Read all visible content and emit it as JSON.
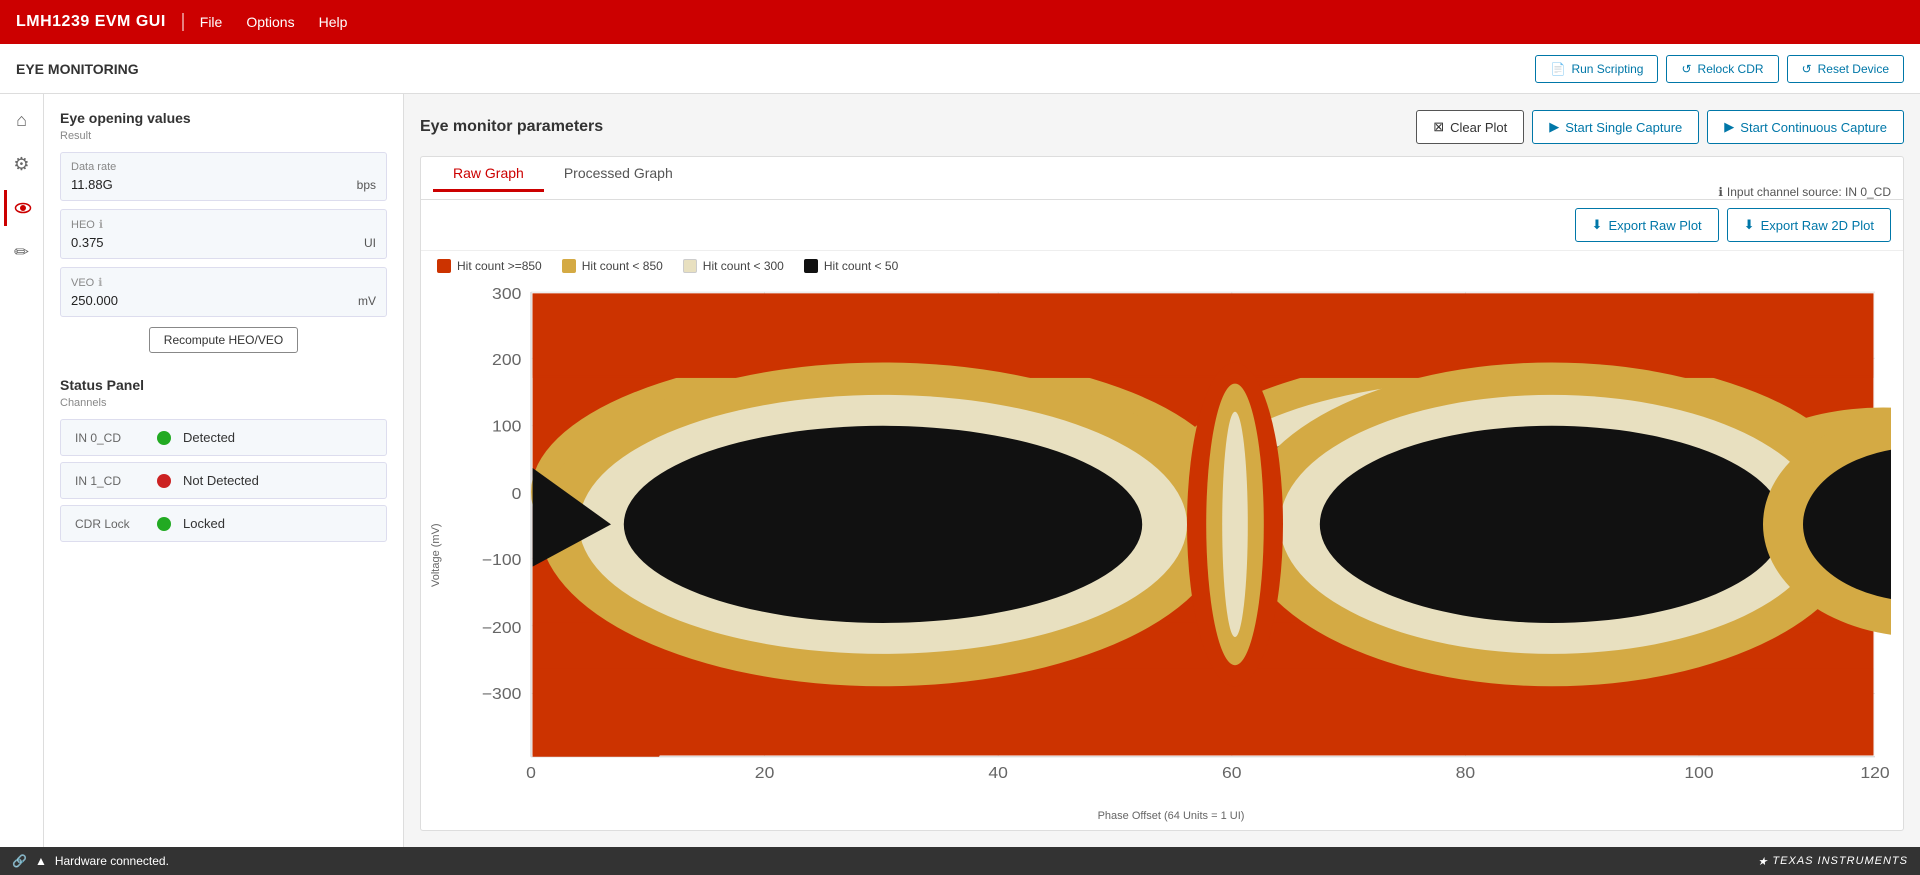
{
  "app": {
    "title": "LMH1239 EVM GUI",
    "nav": [
      "File",
      "Options",
      "Help"
    ]
  },
  "toolbar": {
    "section_title": "EYE MONITORING",
    "btn_run_scripting": "Run Scripting",
    "btn_relock_cdr": "Relock CDR",
    "btn_reset_device": "Reset Device"
  },
  "left_panel": {
    "eye_opening": {
      "title": "Eye opening values",
      "subtitle": "Result",
      "data_rate_label": "Data rate",
      "data_rate_value": "11.88G",
      "data_rate_unit": "bps",
      "heo_label": "HEO",
      "heo_value": "0.375",
      "heo_unit": "UI",
      "veo_label": "VEO",
      "veo_value": "250.000",
      "veo_unit": "mV",
      "recompute_btn": "Recompute HEO/VEO"
    },
    "status_panel": {
      "title": "Status Panel",
      "subtitle": "Channels",
      "channels": [
        {
          "name": "IN 0_CD",
          "status": "Detected",
          "color": "#22aa22"
        },
        {
          "name": "IN 1_CD",
          "status": "Not Detected",
          "color": "#cc2222"
        },
        {
          "name": "CDR Lock",
          "status": "Locked",
          "color": "#22aa22"
        }
      ]
    }
  },
  "main": {
    "title": "Eye monitor parameters",
    "btn_clear_plot": "Clear Plot",
    "btn_start_single": "Start Single Capture",
    "btn_start_continuous": "Start Continuous Capture",
    "tabs": [
      "Raw Graph",
      "Processed Graph"
    ],
    "active_tab": 0,
    "input_channel_source": "Input channel source: IN 0_CD",
    "btn_export_raw": "Export Raw Plot",
    "btn_export_2d": "Export Raw 2D Plot",
    "legend": [
      {
        "label": "Hit count >=850",
        "color": "#cc3300"
      },
      {
        "label": "Hit count < 850",
        "color": "#d4aa44"
      },
      {
        "label": "Hit count < 300",
        "color": "#e8e0c0"
      },
      {
        "label": "Hit count < 50",
        "color": "#111111"
      }
    ],
    "y_axis_label": "Voltage (mV)",
    "x_axis_label": "Phase Offset (64 Units = 1 UI)",
    "y_ticks": [
      "300",
      "200",
      "100",
      "0",
      "-100",
      "-200",
      "-300"
    ],
    "x_ticks": [
      "0",
      "20",
      "40",
      "60",
      "80",
      "100",
      "120"
    ]
  },
  "statusbar": {
    "status_text": "Hardware connected.",
    "ti_logo": "Texas Instruments"
  },
  "icons": {
    "home": "⌂",
    "sliders": "⚙",
    "eye": "👁",
    "pen": "✏",
    "link": "🔗",
    "arrow_up": "▲",
    "run_scripting": "📄",
    "reload": "↺",
    "clear_plot": "⊠",
    "play_circle": "▶",
    "download": "⬇",
    "info": "ℹ"
  }
}
